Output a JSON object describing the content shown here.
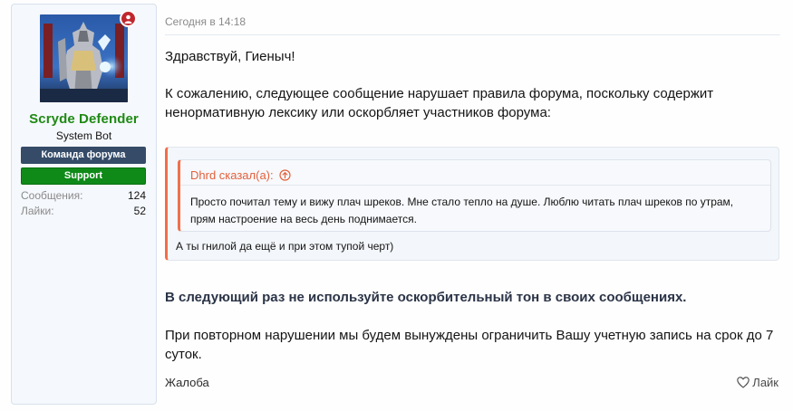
{
  "user": {
    "name": "Scryde Defender",
    "title": "System Bot",
    "banners": {
      "team": "Команда форума",
      "support": "Support"
    },
    "stats": {
      "messages_label": "Сообщения:",
      "messages_value": "124",
      "likes_label": "Лайки:",
      "likes_value": "52"
    }
  },
  "post": {
    "date": "Сегодня в 14:18",
    "greeting": "Здравствуй, Гиеныч!",
    "intro": "К сожалению, следующее сообщение нарушает правила форума, поскольку содержит ненормативную лексику или оскорбляет участников форума:",
    "quote": {
      "author": "Dhrd сказал(а):",
      "text": "Просто почитал тему и вижу плач шреков. Мне стало тепло на душе. Люблю читать плач шреков по утрам, прям настроение на весь день поднимается.",
      "reply": "А ты гнилой да ещё и при этом тупой черт)"
    },
    "warning": "В следующий раз не используйте оскорбительный тон в своих сообщениях.",
    "notice": "При повторном нарушении мы будем вынуждены ограничить Вашу учетную запись на срок до 7 суток.",
    "actions": {
      "report": "Жалоба",
      "like": "Лайк"
    }
  },
  "colors": {
    "username": "#1f8a14",
    "team_banner": "#354b68",
    "support_banner": "#0f8a19",
    "quote_accent": "#f16e4b",
    "online_badge": "#c0272d"
  },
  "icons": {
    "online": "user-online-icon",
    "quote_jump": "arrow-up-circle-icon",
    "like": "heart-icon"
  }
}
